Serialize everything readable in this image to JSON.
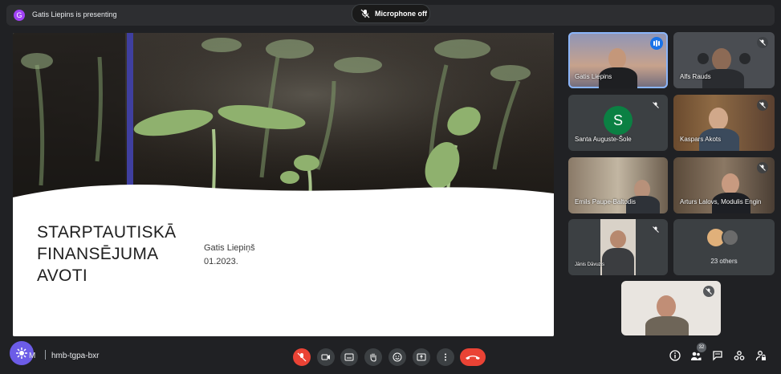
{
  "banner": {
    "avatar_letter": "G",
    "text": "Gatis Liepins is presenting"
  },
  "mic_status": {
    "label": "Microphone off"
  },
  "slide": {
    "title_lines": [
      "STARPTAUTISKĀ",
      "FINANSĒJUMA",
      "AVOTI"
    ],
    "author": "Gatis Liepiņš",
    "date": "01.2023."
  },
  "participants": [
    {
      "name": "Gatis Liepins",
      "speaking": true
    },
    {
      "name": "Alfs Rauds",
      "muted": true
    },
    {
      "name": "Santa Auguste-Šole",
      "avatar_letter": "S",
      "muted": true
    },
    {
      "name": "Kaspars Akots",
      "muted": true
    },
    {
      "name": "Emils Paupe-Baltodis",
      "muted": true
    },
    {
      "name": "Arturs Lalovs, Modulis Engin",
      "muted": true
    },
    {
      "name": "Jānis Dāvuzis",
      "muted": true
    },
    {
      "name": "23 others"
    }
  ],
  "bottom": {
    "time_fragment": "M",
    "meeting_code": "hmb-tgpa-bxr",
    "people_count": "32"
  },
  "colors": {
    "background": "#202124",
    "end_call": "#ea4335",
    "speaking": "#1a73e8",
    "slide_accent": "#3f3f9f"
  }
}
